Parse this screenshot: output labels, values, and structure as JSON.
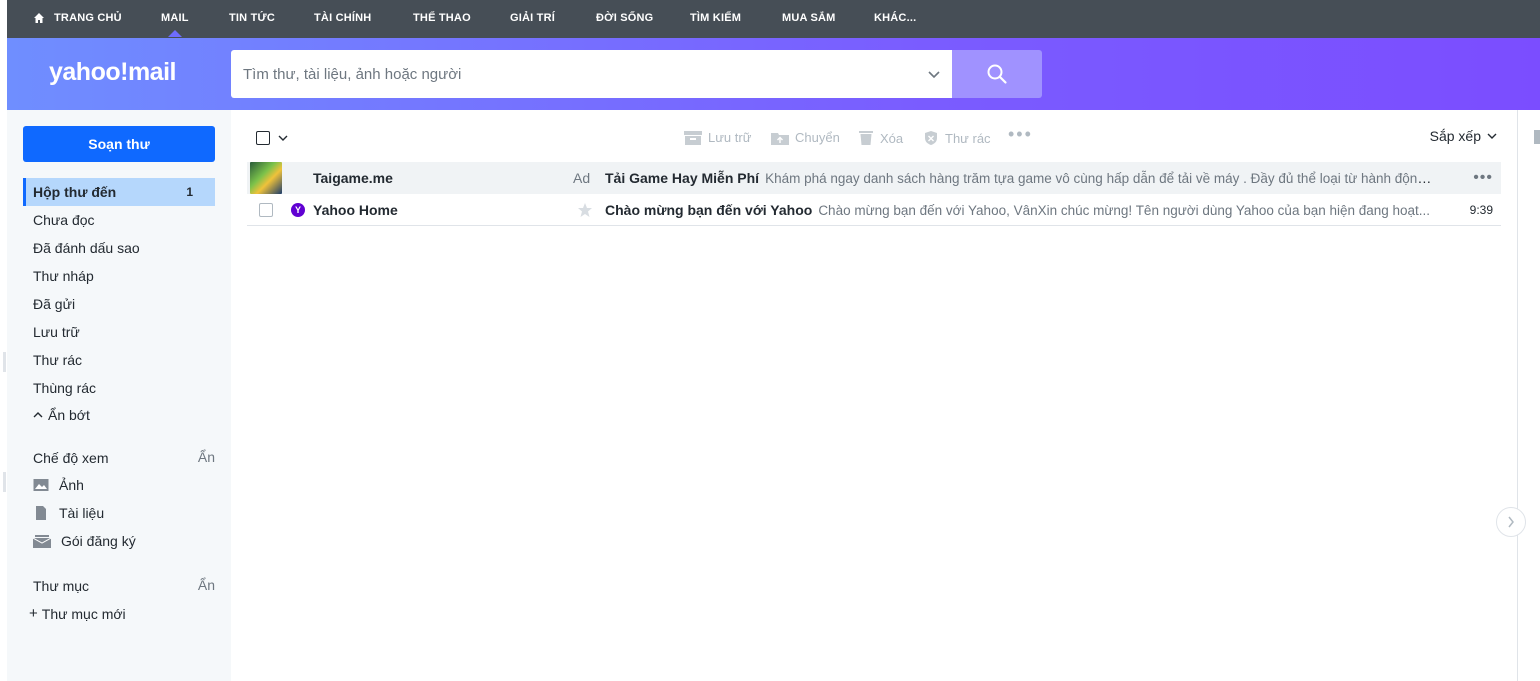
{
  "topnav": {
    "items": [
      "TRANG CHỦ",
      "MAIL",
      "TIN TỨC",
      "TÀI CHÍNH",
      "THỂ THAO",
      "GIẢI TRÍ",
      "ĐỜI SỐNG",
      "TÌM KIẾM",
      "MUA SẮM",
      "KHÁC..."
    ],
    "active": "MAIL"
  },
  "header": {
    "logo": "yahoo!mail",
    "search_placeholder": "Tìm thư, tài liệu, ảnh hoặc người"
  },
  "sidebar": {
    "compose_label": "Soạn thư",
    "folders": [
      {
        "label": "Hộp thư đến",
        "count": "1"
      },
      {
        "label": "Chưa đọc"
      },
      {
        "label": "Đã đánh dấu sao"
      },
      {
        "label": "Thư nháp"
      },
      {
        "label": "Đã gửi"
      },
      {
        "label": "Lưu trữ"
      },
      {
        "label": "Thư rác"
      },
      {
        "label": "Thùng rác"
      }
    ],
    "collapse_label": "Ẩn bớt",
    "views": {
      "title": "Chế độ xem",
      "hide": "Ẩn",
      "items": [
        "Ảnh",
        "Tài liệu",
        "Gói đăng ký"
      ]
    },
    "folders_section": {
      "title": "Thư mục",
      "hide": "Ẩn",
      "new_folder": "Thư mục mới"
    }
  },
  "toolbar": {
    "archive": "Lưu trữ",
    "move": "Chuyển",
    "delete": "Xóa",
    "spam": "Thư rác",
    "sort": "Sắp xếp"
  },
  "messages": [
    {
      "type": "ad",
      "sender": "Taigame.me",
      "label": "Ad",
      "subject": "Tải Game Hay Miễn Phí",
      "snippet": "Khám phá ngay danh sách hàng trăm tựa game vô cùng hấp dẫn để tải về máy . Đầy đủ thể loại từ hành động cho đ..."
    },
    {
      "type": "mail",
      "sender": "Yahoo Home",
      "subject": "Chào mừng bạn đến với Yahoo",
      "snippet": "Chào mừng bạn đến với Yahoo, VânXin chúc mừng! Tên người dùng Yahoo của bạn hiện đang hoạt...",
      "time": "9:39"
    }
  ]
}
